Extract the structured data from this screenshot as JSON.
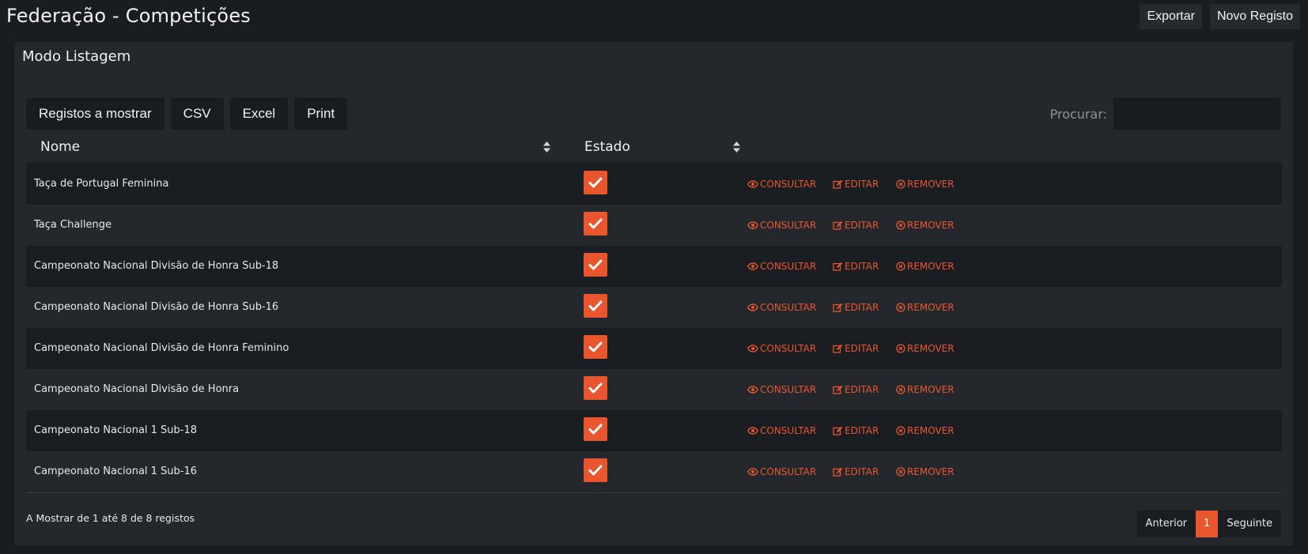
{
  "header": {
    "title": "Federação - Competições",
    "export_label": "Exportar",
    "new_label": "Novo Registo"
  },
  "panel": {
    "title": "Modo Listagem"
  },
  "toolbar": {
    "buttons": [
      "Registos a mostrar",
      "CSV",
      "Excel",
      "Print"
    ],
    "search_label": "Procurar:",
    "search_value": ""
  },
  "table": {
    "columns": [
      "Nome",
      "Estado"
    ],
    "rows": [
      {
        "nome": "Taça de Portugal Feminina",
        "estado": true
      },
      {
        "nome": "Taça Challenge",
        "estado": true
      },
      {
        "nome": "Campeonato Nacional Divisão de Honra Sub-18",
        "estado": true
      },
      {
        "nome": "Campeonato Nacional Divisão de Honra Sub-16",
        "estado": true
      },
      {
        "nome": "Campeonato Nacional Divisão de Honra Feminino",
        "estado": true
      },
      {
        "nome": "Campeonato Nacional Divisão de Honra",
        "estado": true
      },
      {
        "nome": "Campeonato Nacional 1 Sub-18",
        "estado": true
      },
      {
        "nome": "Campeonato Nacional 1 Sub-16",
        "estado": true
      }
    ],
    "actions": {
      "view": "CONSULTAR",
      "edit": "EDITAR",
      "remove": "REMOVER"
    }
  },
  "footer": {
    "info": "A Mostrar de 1 até 8 de 8 registos",
    "prev": "Anterior",
    "page": "1",
    "next": "Seguinte"
  },
  "colors": {
    "accent": "#e9562e",
    "background": "#191c20",
    "panel": "#24282d"
  },
  "icons": {
    "view": "eye-icon",
    "edit": "edit-icon",
    "remove": "times-circle-icon",
    "check": "check-icon",
    "sort": "sort-icon"
  }
}
